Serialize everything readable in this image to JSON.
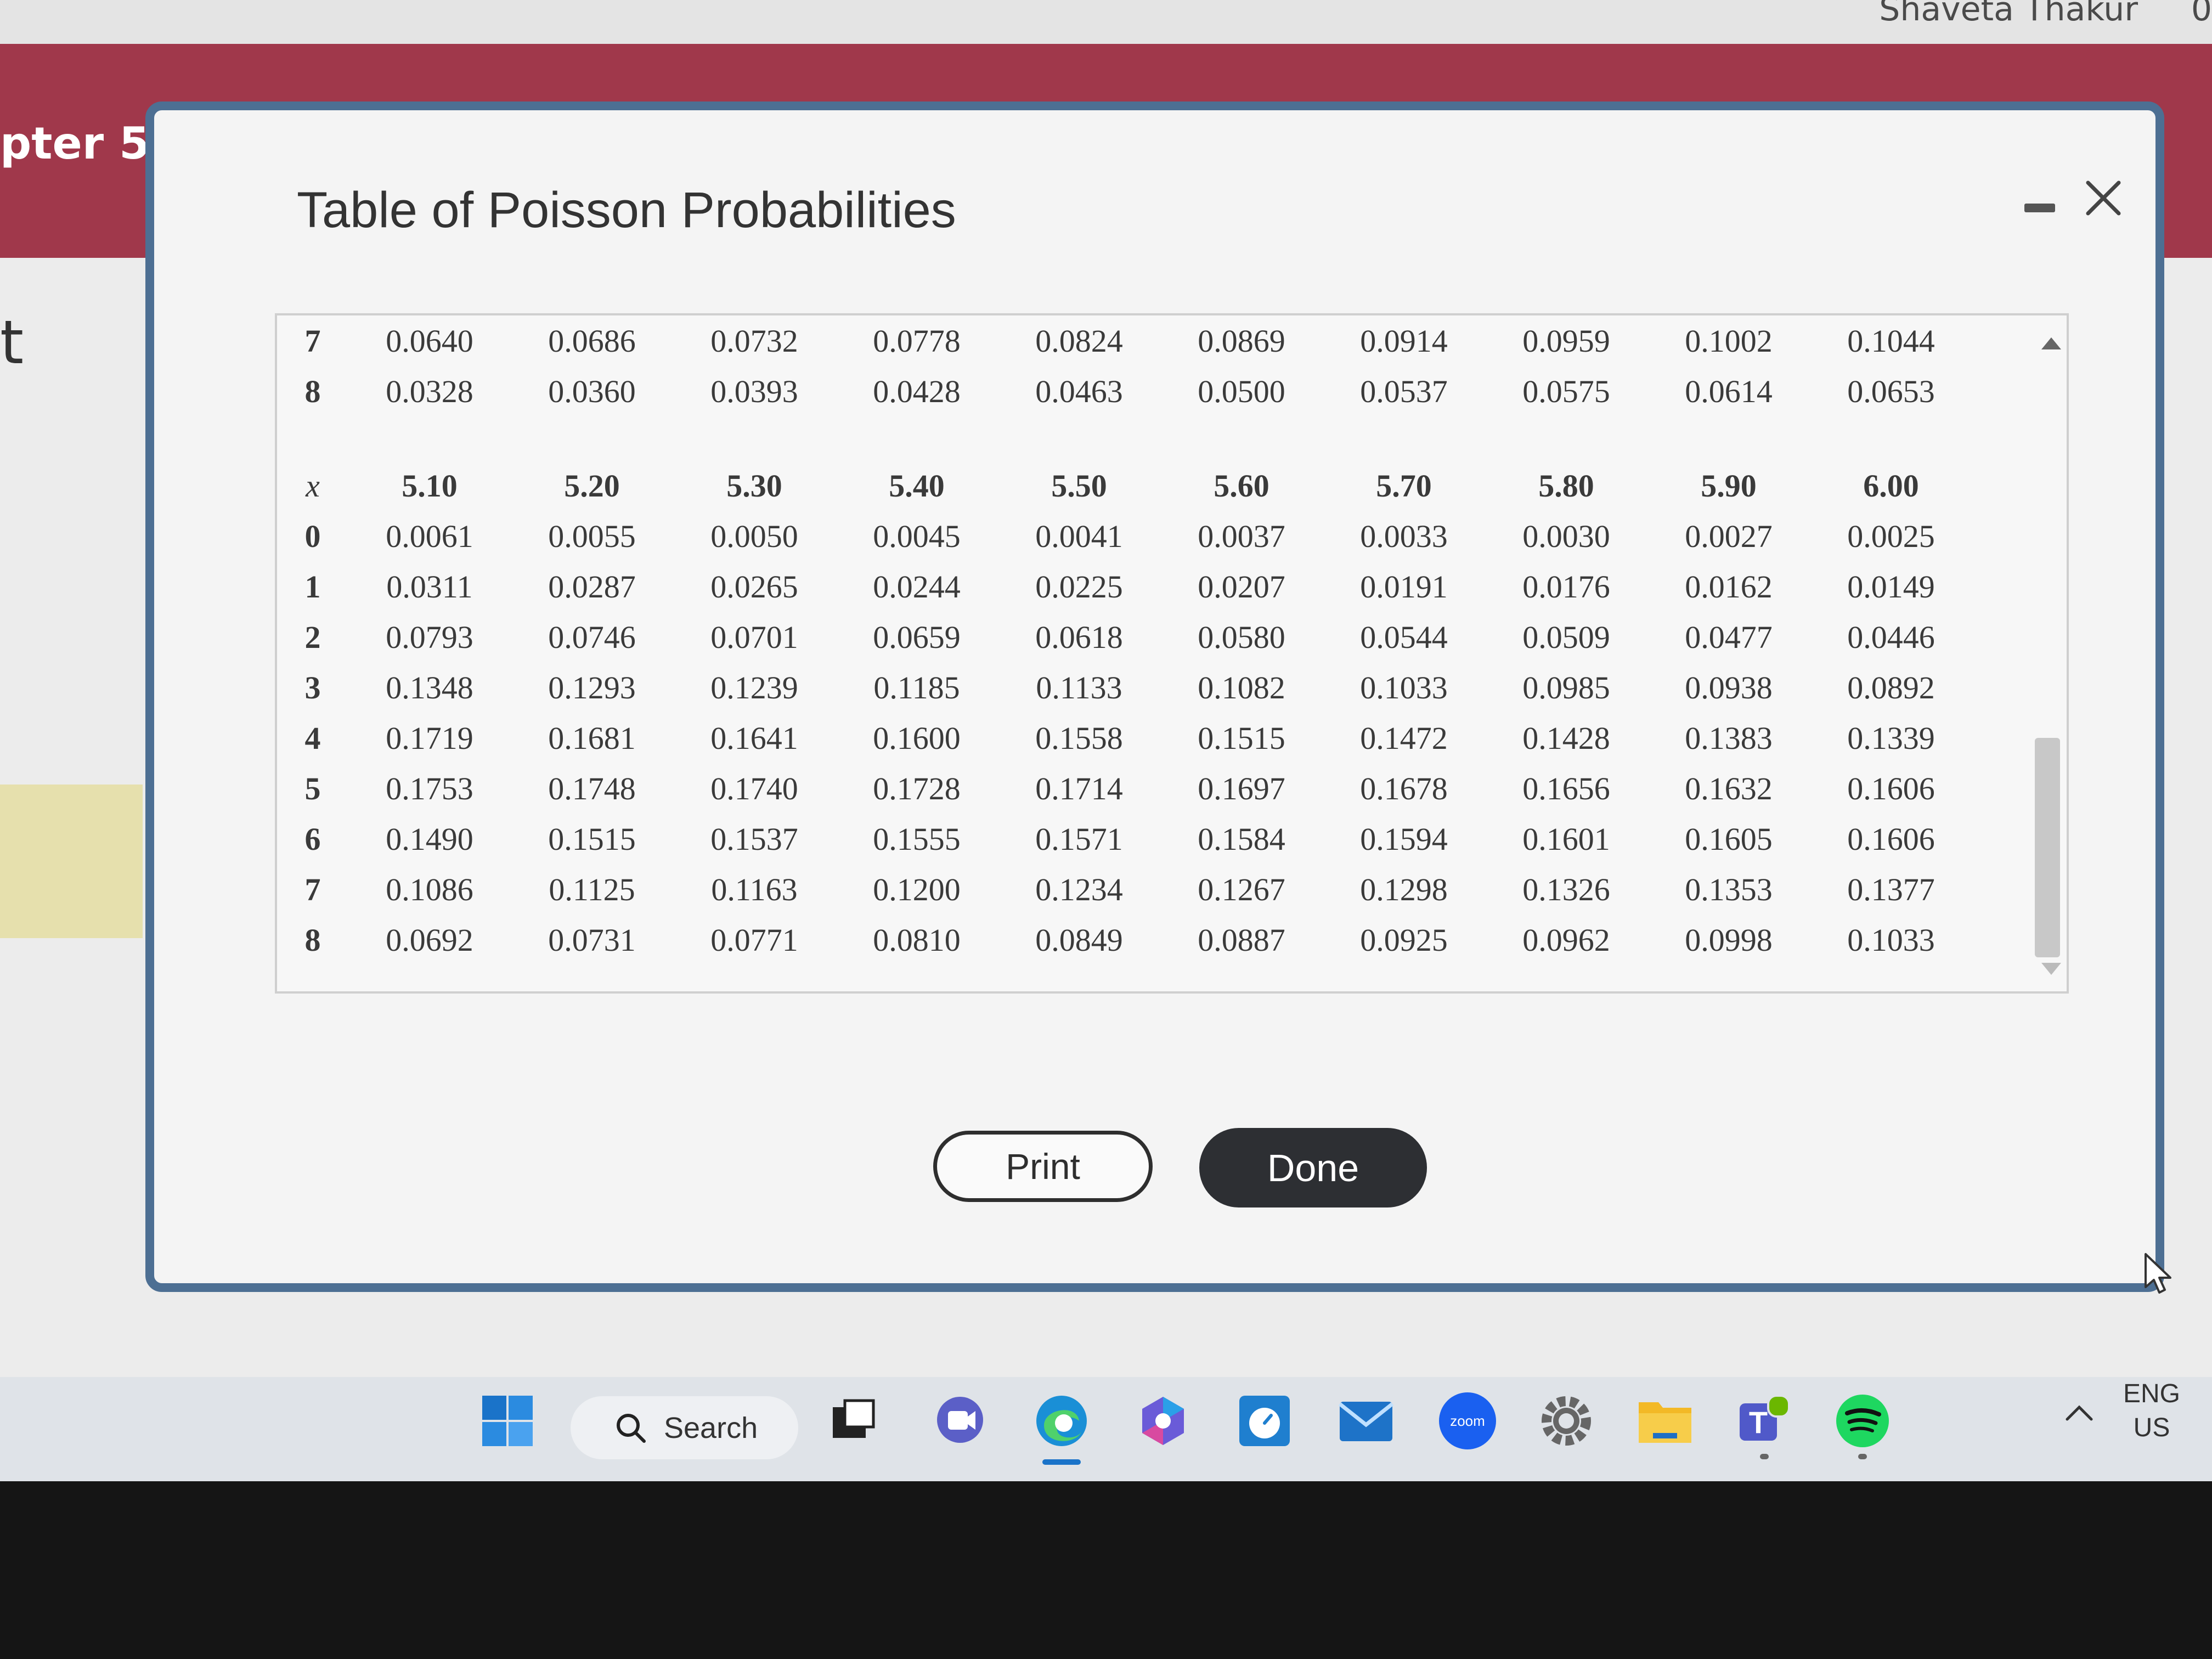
{
  "background": {
    "user_name": "Shaveta Thakur",
    "user_extra": "0",
    "chapter_label": "pter 5 /",
    "page_letter": "t"
  },
  "dialog": {
    "title": "Table of Poisson Probabilities",
    "minimize_icon": "minimize-icon",
    "close_icon": "close-icon",
    "print_label": "Print",
    "done_label": "Done"
  },
  "table": {
    "top_rows": [
      {
        "x": "7",
        "values": [
          "0.0640",
          "0.0686",
          "0.0732",
          "0.0778",
          "0.0824",
          "0.0869",
          "0.0914",
          "0.0959",
          "0.1002",
          "0.1044"
        ]
      },
      {
        "x": "8",
        "values": [
          "0.0328",
          "0.0360",
          "0.0393",
          "0.0428",
          "0.0463",
          "0.0500",
          "0.0537",
          "0.0575",
          "0.0614",
          "0.0653"
        ]
      }
    ],
    "x_label": "x",
    "lambdas": [
      "5.10",
      "5.20",
      "5.30",
      "5.40",
      "5.50",
      "5.60",
      "5.70",
      "5.80",
      "5.90",
      "6.00"
    ],
    "rows": [
      {
        "x": "0",
        "values": [
          "0.0061",
          "0.0055",
          "0.0050",
          "0.0045",
          "0.0041",
          "0.0037",
          "0.0033",
          "0.0030",
          "0.0027",
          "0.0025"
        ]
      },
      {
        "x": "1",
        "values": [
          "0.0311",
          "0.0287",
          "0.0265",
          "0.0244",
          "0.0225",
          "0.0207",
          "0.0191",
          "0.0176",
          "0.0162",
          "0.0149"
        ]
      },
      {
        "x": "2",
        "values": [
          "0.0793",
          "0.0746",
          "0.0701",
          "0.0659",
          "0.0618",
          "0.0580",
          "0.0544",
          "0.0509",
          "0.0477",
          "0.0446"
        ]
      },
      {
        "x": "3",
        "values": [
          "0.1348",
          "0.1293",
          "0.1239",
          "0.1185",
          "0.1133",
          "0.1082",
          "0.1033",
          "0.0985",
          "0.0938",
          "0.0892"
        ]
      },
      {
        "x": "4",
        "values": [
          "0.1719",
          "0.1681",
          "0.1641",
          "0.1600",
          "0.1558",
          "0.1515",
          "0.1472",
          "0.1428",
          "0.1383",
          "0.1339"
        ]
      },
      {
        "x": "5",
        "values": [
          "0.1753",
          "0.1748",
          "0.1740",
          "0.1728",
          "0.1714",
          "0.1697",
          "0.1678",
          "0.1656",
          "0.1632",
          "0.1606"
        ]
      },
      {
        "x": "6",
        "values": [
          "0.1490",
          "0.1515",
          "0.1537",
          "0.1555",
          "0.1571",
          "0.1584",
          "0.1594",
          "0.1601",
          "0.1605",
          "0.1606"
        ]
      },
      {
        "x": "7",
        "values": [
          "0.1086",
          "0.1125",
          "0.1163",
          "0.1200",
          "0.1234",
          "0.1267",
          "0.1298",
          "0.1326",
          "0.1353",
          "0.1377"
        ]
      },
      {
        "x": "8",
        "values": [
          "0.0692",
          "0.0731",
          "0.0771",
          "0.0810",
          "0.0849",
          "0.0887",
          "0.0925",
          "0.0962",
          "0.0998",
          "0.1033"
        ]
      }
    ]
  },
  "taskbar": {
    "search_label": "Search",
    "lang_line1": "ENG",
    "lang_line2": "US",
    "zoom_label": "zoom",
    "teams_label": "T",
    "icons": [
      "windows-start-icon",
      "search-icon",
      "task-view-icon",
      "chat-icon",
      "edge-icon",
      "copilot-icon",
      "clock-icon",
      "mail-icon",
      "zoom-icon",
      "settings-icon",
      "file-explorer-icon",
      "teams-icon",
      "spotify-icon"
    ]
  }
}
